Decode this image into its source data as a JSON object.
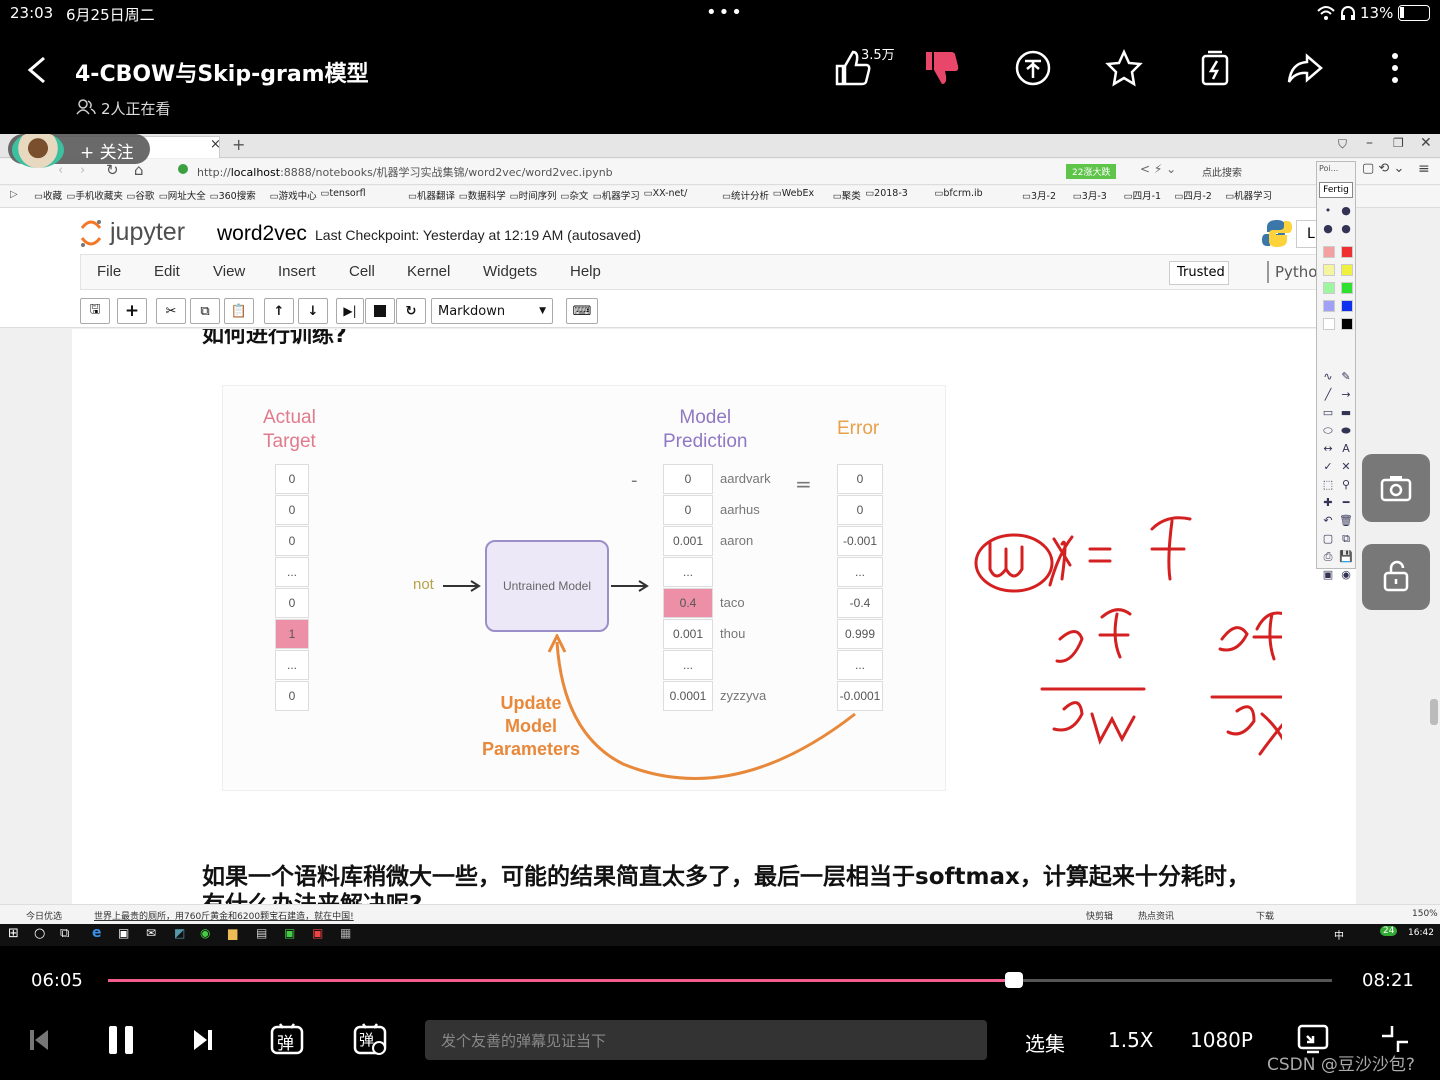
{
  "status": {
    "time": "23:03",
    "date": "6月25日周二",
    "battery": "13%"
  },
  "top": {
    "title": "4-CBOW与Skip-gram模型",
    "watching": "2人正在看",
    "likes": "3.5万",
    "follow": "+ 关注"
  },
  "browser": {
    "url_prefix": "http://",
    "url_host": "localhost",
    "url_rest": ":8888/notebooks/机器学习实战集锦/word2vec/word2vec.ipynb",
    "badge": "22涨大跌",
    "search": "点此搜索",
    "bookmarks": [
      "收藏",
      "手机收藏夹",
      "谷歌",
      "网址大全",
      "360搜索",
      "游戏中心",
      "tensorfl",
      "机器翻译",
      "数据科学",
      "时间序列",
      "杂文",
      "机器学习",
      "XX-net/",
      "统计分析",
      "WebEx",
      "聚类",
      "2018-3",
      "bfcrm.ib",
      "3月-2",
      "3月-3",
      "四月-1",
      "四月-2",
      "机器学习"
    ]
  },
  "jupyter": {
    "logo": "jupyter",
    "notebook": "word2vec",
    "checkpoint": "Last Checkpoint: Yesterday at 12:19 AM (autosaved)",
    "menu": [
      "File",
      "Edit",
      "View",
      "Insert",
      "Cell",
      "Kernel",
      "Widgets",
      "Help"
    ],
    "trusted": "Trusted",
    "kernel": "Python",
    "logout": "L",
    "cell_type": "Markdown",
    "heading_cut": "如何进行训练?",
    "bottom_text": "如果一个语料库稍微大一些，可能的结果简直太多了，最后一层相当于softmax，计算起来十分耗时，",
    "bottom_text2": "有什么办法来解决呢?"
  },
  "figure": {
    "actual_target": [
      "Actual",
      "Target"
    ],
    "model_prediction": [
      "Model",
      "Prediction"
    ],
    "error": "Error",
    "targets": [
      "0",
      "0",
      "0",
      "...",
      "0",
      "1",
      "...",
      "0"
    ],
    "predictions": [
      "0",
      "0",
      "0.001",
      "...",
      "0.4",
      "0.001",
      "...",
      "0.0001"
    ],
    "words": [
      "aardvark",
      "aarhus",
      "aaron",
      "",
      "taco",
      "thou",
      "",
      "zyzzyva"
    ],
    "errors": [
      "0",
      "0",
      "-0.001",
      "...",
      "-0.4",
      "0.999",
      "...",
      "-0.0001"
    ],
    "input_word": "not",
    "model_label": "Untrained Model",
    "update": [
      "Update",
      "Model",
      "Parameters"
    ],
    "minus": "-",
    "equals": "="
  },
  "paint": {
    "title": "Poi...",
    "done": "Fertig"
  },
  "taskbar": {
    "left": "今日优选",
    "news": "世界上最贵的厕所，用760斤黄金和6200颗宝石建造，就在中国!",
    "right": [
      "快剪辑",
      "热点资讯",
      "下载",
      "150%"
    ],
    "clock": "16:42",
    "ime": "中"
  },
  "player": {
    "elapsed": "06:05",
    "total": "08:21",
    "progress": 0.74,
    "danmaku_placeholder": "发个友善的弹幕见证当下",
    "episodes": "选集",
    "speed": "1.5X",
    "quality": "1080P",
    "watermark": "CSDN @豆沙沙包?",
    "danmaku_btn": "弹"
  }
}
